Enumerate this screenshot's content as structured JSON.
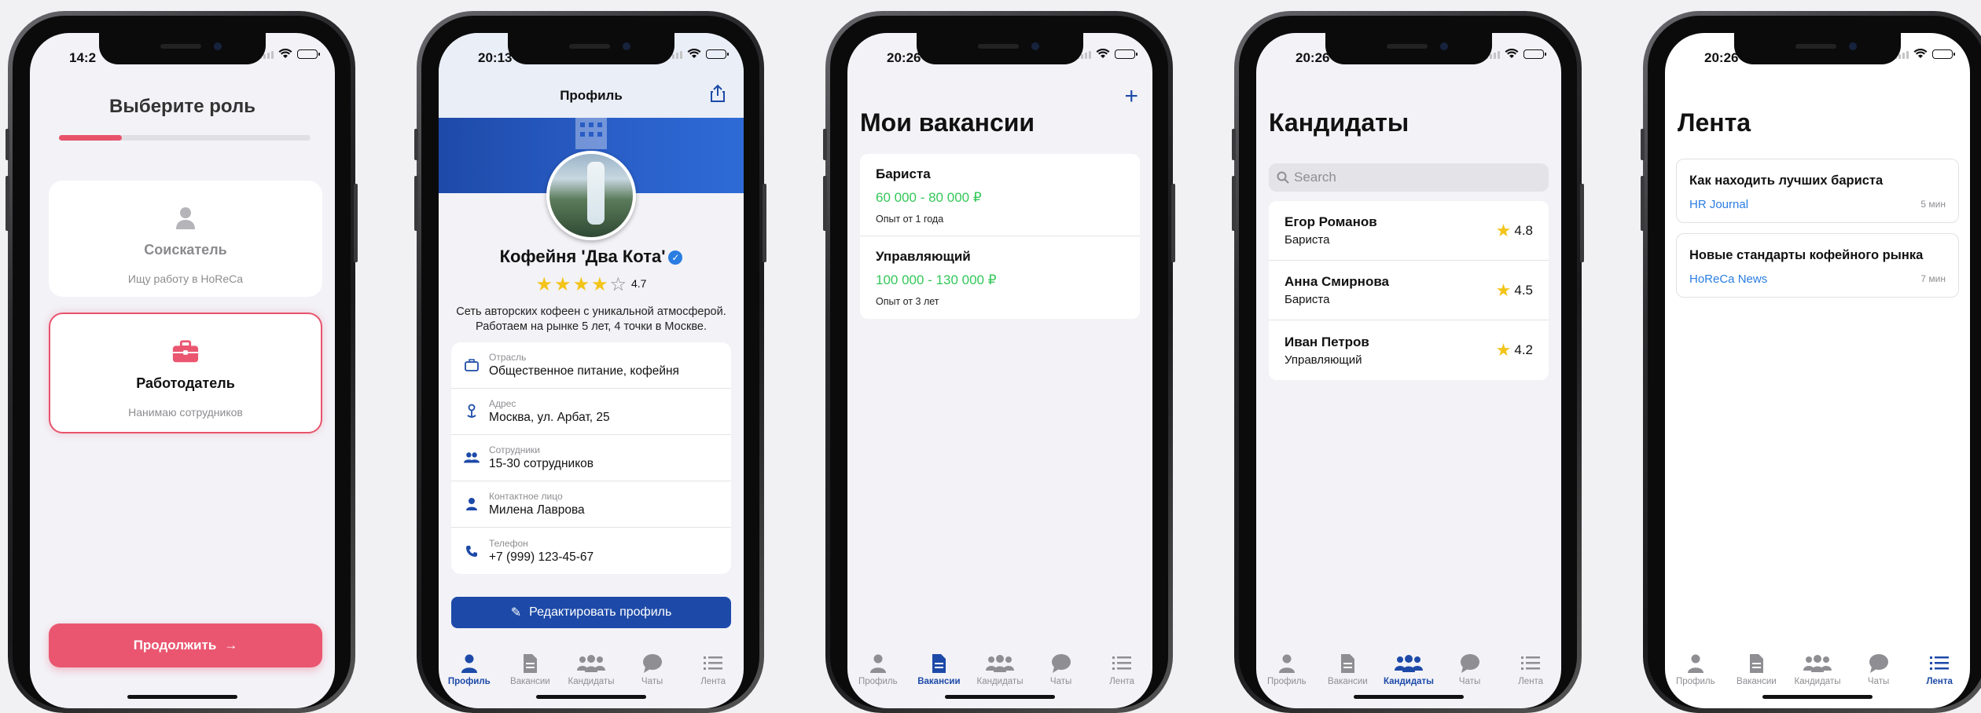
{
  "status": {
    "time_1": "14:2",
    "time_2": "20:13",
    "time_3": "20:26",
    "time_4": "20:26",
    "time_5": "20:26"
  },
  "tabs": [
    "Профиль",
    "Вакансии",
    "Кандидаты",
    "Чаты",
    "Лента"
  ],
  "role_select": {
    "title": "Выберите роль",
    "progress": 0.25,
    "seeker": {
      "name": "Соискатель",
      "desc": "Ищу работу в HoReCa",
      "icon": "person-icon"
    },
    "employer": {
      "name": "Работодатель",
      "desc": "Нанимаю сотрудников",
      "icon": "briefcase-icon"
    },
    "continue_label": "Продолжить",
    "accent": "#ea5670"
  },
  "profile": {
    "nav_title": "Профиль",
    "company_name": "Кофейня 'Два Кота'",
    "rating": "4.7",
    "stars_filled": 4,
    "about": "Сеть авторских кофеен с уникальной атмосферой. Работаем на рынке 5 лет, 4 точки в Москве.",
    "fields": [
      {
        "label": "Отрасль",
        "value": "Общественное питание, кофейня",
        "icon": "briefcase-icon"
      },
      {
        "label": "Адрес",
        "value": "Москва, ул. Арбат, 25",
        "icon": "location-pin-icon"
      },
      {
        "label": "Сотрудники",
        "value": "15-30 сотрудников",
        "icon": "people-icon"
      },
      {
        "label": "Контактное лицо",
        "value": "Милена Лаврова",
        "icon": "person-icon"
      },
      {
        "label": "Телефон",
        "value": "+7 (999) 123-45-67",
        "icon": "phone-icon"
      }
    ],
    "edit_label": "Редактировать профиль",
    "primary": "#1d4aa8"
  },
  "vacancies": {
    "title": "Мои вакансии",
    "add_label": "+",
    "items": [
      {
        "title": "Бариста",
        "salary": "60 000 - 80 000 ₽",
        "exp": "Опыт от 1 года"
      },
      {
        "title": "Управляющий",
        "salary": "100 000 - 130 000 ₽",
        "exp": "Опыт от 3 лет"
      }
    ],
    "salary_color": "#34c759"
  },
  "candidates": {
    "title": "Кандидаты",
    "search_placeholder": "Search",
    "items": [
      {
        "name": "Егор Романов",
        "role": "Бариста",
        "rating": "4.8"
      },
      {
        "name": "Анна Смирнова",
        "role": "Бариста",
        "rating": "4.5"
      },
      {
        "name": "Иван Петров",
        "role": "Управляющий",
        "rating": "4.2"
      }
    ]
  },
  "feed": {
    "title": "Лента",
    "items": [
      {
        "title": "Как находить лучших бариста",
        "source": "HR Journal",
        "time": "5 мин"
      },
      {
        "title": "Новые стандарты кофейного рынка",
        "source": "HoReCa News",
        "time": "7 мин"
      }
    ]
  }
}
